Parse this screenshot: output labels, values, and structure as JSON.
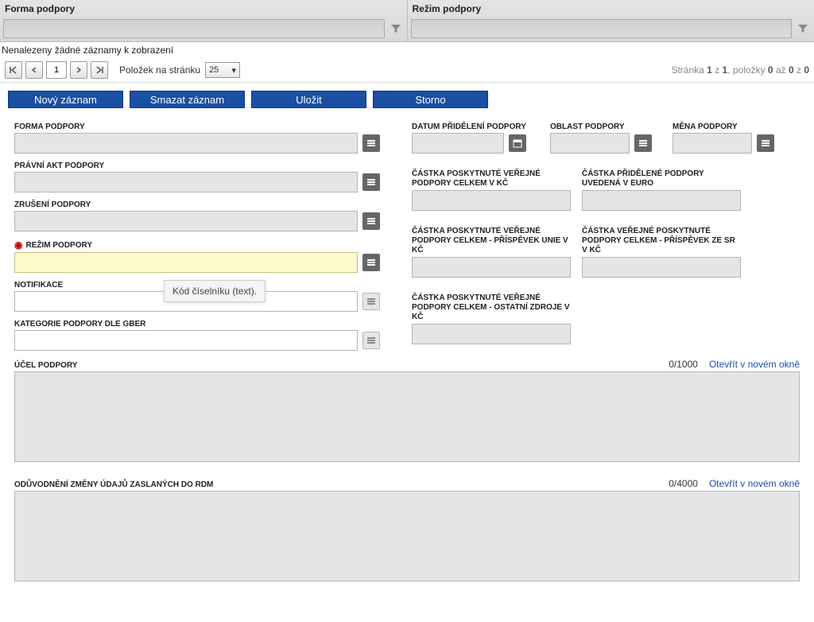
{
  "filters": {
    "col1_label": "Forma podpory",
    "col2_label": "Režim podpory"
  },
  "no_records": "Nenalezeny žádné záznamy k zobrazení",
  "pager": {
    "page_value": "1",
    "per_page_label": "Položek na stránku",
    "per_page_value": "25",
    "info_prefix": "Stránka ",
    "info_p1": "1",
    "info_mid1": " z ",
    "info_p2": "1",
    "info_mid2": ", položky ",
    "info_p3": "0",
    "info_mid3": " až ",
    "info_p4": "0",
    "info_mid4": " z ",
    "info_p5": "0"
  },
  "actions": {
    "new": "Nový záznam",
    "delete": "Smazat záznam",
    "save": "Uložit",
    "cancel": "Storno"
  },
  "labels": {
    "forma": "FORMA PODPORY",
    "pravni": "PRÁVNÍ AKT PODPORY",
    "zruseni": "ZRUŠENÍ PODPORY",
    "rezim": "REŽIM PODPORY",
    "notif": "NOTIFIKACE",
    "kategorie": "KATEGORIE PODPORY DLE GBER",
    "datum": "DATUM PŘIDĚLENÍ PODPORY",
    "oblast": "OBLAST PODPORY",
    "mena": "MĚNA PODPORY",
    "castka_kc": "ČÁSTKA POSKYTNUTÉ VEŘEJNÉ PODPORY CELKEM V KČ",
    "castka_eur": "ČÁSTKA PŘIDĚLENÉ PODPORY UVEDENÁ V EURO",
    "castka_unie": "ČÁSTKA POSKYTNUTÉ VEŘEJNÉ PODPORY CELKEM - PŘÍSPĚVEK UNIE V KČ",
    "castka_sr": "ČÁSTKA VEŘEJNÉ POSKYTNUTÉ PODPORY CELKEM - PŘÍSPĚVEK ZE SR V KČ",
    "castka_ost": "ČÁSTKA POSKYTNUTÉ VEŘEJNÉ PODPORY CELKEM - OSTATNÍ ZDROJE V KČ",
    "ucel": "ÚČEL PODPORY",
    "oduvod": "ODŮVODNĚNÍ ZMĚNY ÚDAJŮ ZASLANÝCH DO RDM"
  },
  "tooltip": "Kód číselníku (text).",
  "ta": {
    "ucel_count": "0/1000",
    "oduvod_count": "0/4000",
    "open_link": "Otevřít v novém okně"
  }
}
